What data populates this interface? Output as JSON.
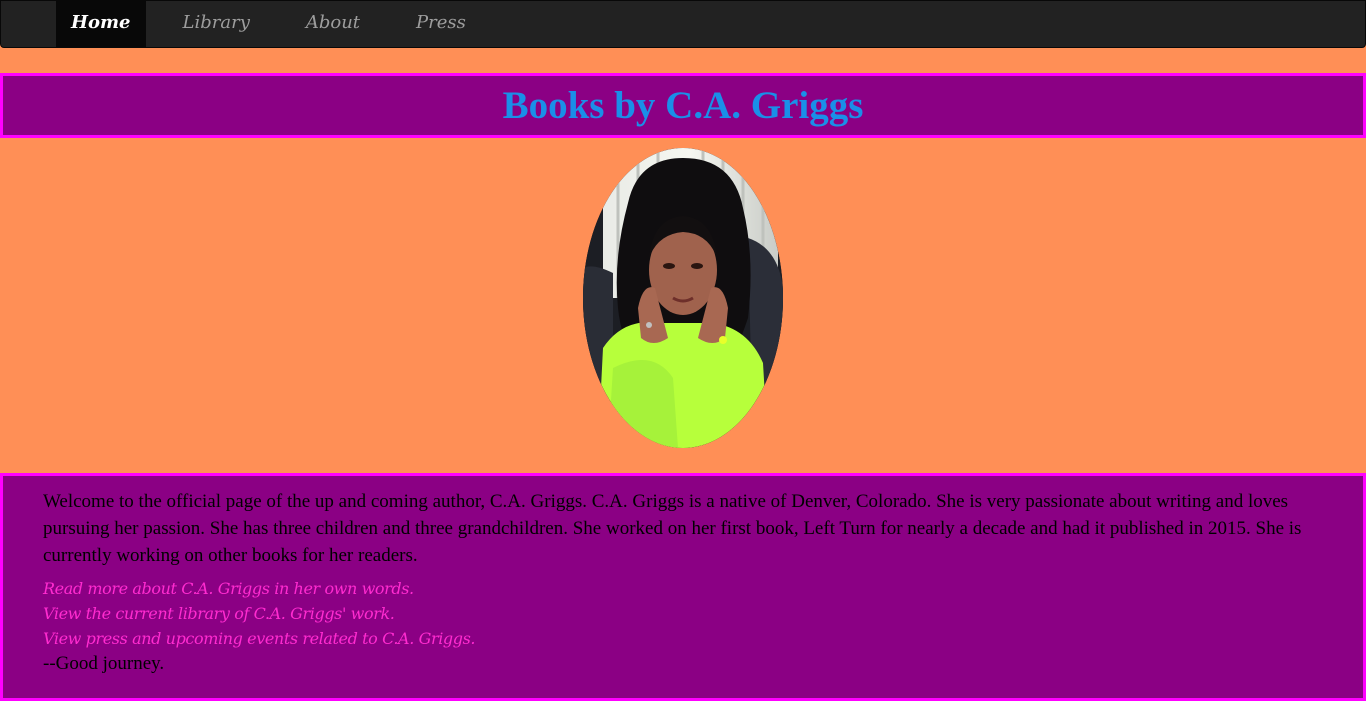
{
  "nav": {
    "items": [
      {
        "label": "Home",
        "active": true
      },
      {
        "label": "Library",
        "active": false
      },
      {
        "label": "About",
        "active": false
      },
      {
        "label": "Press",
        "active": false
      }
    ]
  },
  "header": {
    "title": "Books by C.A. Griggs"
  },
  "content": {
    "intro": "Welcome to the official page of the up and coming author, C.A. Griggs. C.A. Griggs is a native of Denver, Colorado. She is very passionate about writing and loves pursuing her passion. She has three children and three grandchildren. She worked on her first book, Left Turn for nearly a decade and had it published in 2015. She is currently working on other books for her readers.",
    "links": [
      "Read more about C.A. Griggs in her own words.",
      "View the current library of C.A. Griggs' work.",
      "View press and upcoming events related to C.A. Griggs."
    ],
    "signoff": "--Good journey."
  },
  "colors": {
    "page_background": "#ff8f56",
    "panel_background": "#8b0084",
    "panel_border": "#ff00ff",
    "title_text": "#1a8fe8",
    "link_text": "#ff2bd0",
    "navbar_background": "#222222"
  }
}
